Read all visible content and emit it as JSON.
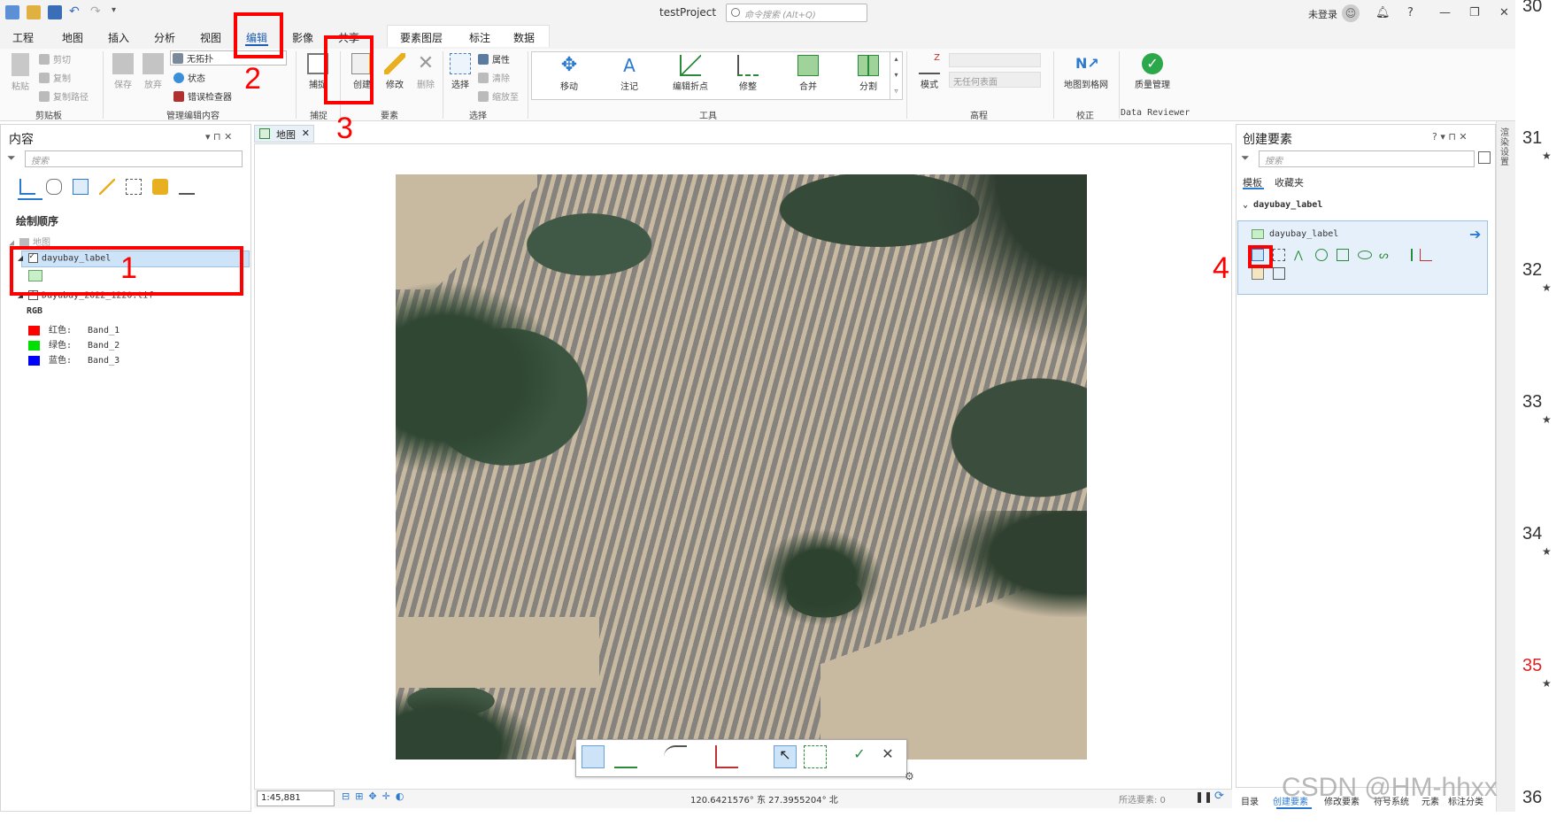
{
  "window": {
    "title": "testProject",
    "command_search_placeholder": "命令搜索 (Alt+Q)",
    "login": "未登录"
  },
  "main_tabs": [
    "工程",
    "地图",
    "插入",
    "分析",
    "视图",
    "编辑",
    "影像",
    "共享"
  ],
  "active_tab": "编辑",
  "context_tabs": [
    "要素图层",
    "标注",
    "数据"
  ],
  "ribbon": {
    "clipboard": {
      "paste": "粘贴",
      "cut": "剪切",
      "copy": "复制",
      "copy_path": "复制路径",
      "group": "剪贴板"
    },
    "manage_edits": {
      "save": "保存",
      "discard": "放弃",
      "topology": "无拓扑",
      "status": "状态",
      "error_inspector": "错误检查器",
      "group": "管理编辑内容"
    },
    "snapping": {
      "snap": "捕捉",
      "group": "捕捉"
    },
    "features": {
      "create": "创建",
      "modify": "修改",
      "delete": "删除",
      "group": "要素"
    },
    "selection": {
      "select": "选择",
      "attributes": "属性",
      "clear": "清除",
      "zoom_to": "缩放至",
      "group": "选择"
    },
    "tools": {
      "items": [
        "移动",
        "注记",
        "编辑折点",
        "修整",
        "合并",
        "分割"
      ],
      "group": "工具"
    },
    "elevation": {
      "mode": "模式",
      "surface_placeholder": "无任何表面",
      "group": "高程"
    },
    "correction": {
      "georef": "地图到格网",
      "group": "校正"
    },
    "reviewer": {
      "quality": "质量管理",
      "group": "Data Reviewer"
    }
  },
  "contents_pane": {
    "title": "内容",
    "search_placeholder": "搜索",
    "section": "绘制顺序",
    "map_node": "地图",
    "layer1": "dayubay_label",
    "layer2": "Dayubay_2022_1220.tif",
    "rgb_label": "RGB",
    "bands": [
      {
        "label": "红色:",
        "band": "Band_1",
        "color": "#ff0000"
      },
      {
        "label": "绿色:",
        "band": "Band_2",
        "color": "#00e000"
      },
      {
        "label": "蓝色:",
        "band": "Band_3",
        "color": "#0000ff"
      }
    ]
  },
  "map_tab": "地图",
  "status": {
    "scale": "1:45,881",
    "coords": "120.6421576° 东 27.3955204° 北",
    "selected": "所选要素: 0"
  },
  "create_pane": {
    "title": "创建要素",
    "search_placeholder": "搜索",
    "tabs": [
      "模板",
      "收藏夹"
    ],
    "group": "dayubay_label",
    "template": "dayubay_label"
  },
  "bottom_tabs": [
    "目录",
    "创建要素",
    "修改要素",
    "符号系统",
    "元素",
    "标注分类"
  ],
  "annotations": [
    "1",
    "2",
    "3",
    "4"
  ],
  "side_numbers": [
    "30",
    "31",
    "32",
    "33",
    "34",
    "35",
    "36"
  ],
  "watermark": "CSDN @HM-hhxx",
  "vertical_tab": "渲染设置"
}
